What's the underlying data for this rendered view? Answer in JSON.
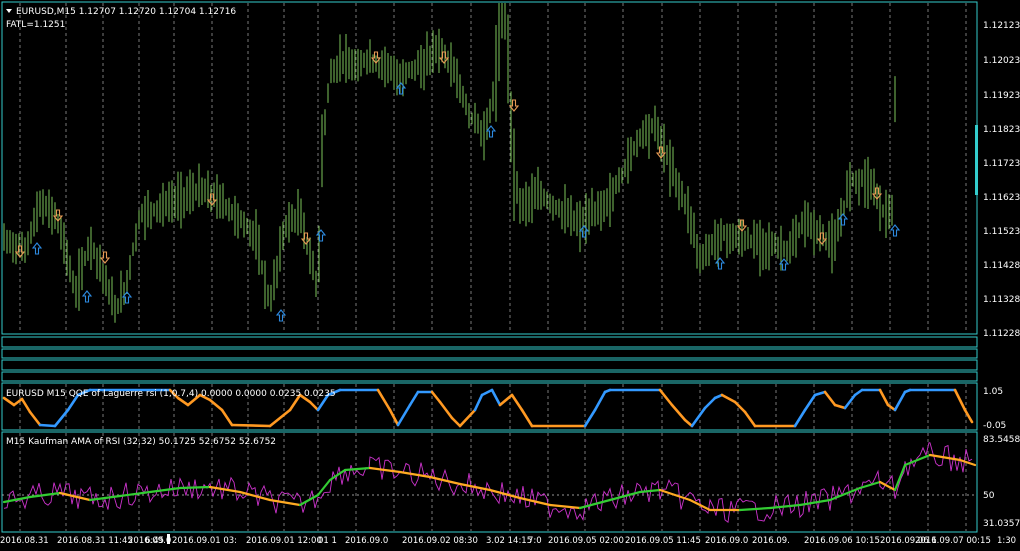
{
  "header": {
    "symbol_line": "EURUSD,M15  1.12707 1.12720 1.12704 1.12716",
    "indicator_line": "FATL=1.1251"
  },
  "main_price_axis": [
    "1.12123",
    "1.12023",
    "1.11923",
    "1.11823",
    "1.11723",
    "1.11623",
    "1.11523",
    "1.11428",
    "1.11328",
    "1.11228"
  ],
  "qqe_panel": {
    "title": "EURUSD M15 QQE of Laguerre rsi (1,0.7,4) 0.0000 0.0000 0.0235 0.0235",
    "axis": [
      "1.05",
      "-0.05"
    ]
  },
  "ama_panel": {
    "title": "M15 Kaufman AMA of RSI (32,32) 50.1725 52.6752 52.6752",
    "axis": [
      "83.5458",
      "50",
      "31.0357"
    ]
  },
  "time_axis": [
    "2016.08.31",
    "2016.08.31 11:45",
    "2016.09.0",
    "6:45",
    "2016.09.01 03:",
    "2016.09.01 12:00",
    "01 1",
    "2016.09.0",
    "2016.09.02 08:30",
    "3.02 14:15",
    "7:0",
    "2016.09.05 02:00",
    "2016.09.05 11:45",
    "2016.09.0",
    "2016.09.",
    "2016.09.06 10:15",
    "2016.09.06 1",
    "2016.09.07 00:15",
    "1:30"
  ],
  "colors": {
    "background": "#000000",
    "grid": "#c8c8c8",
    "candles": "#7bc35a",
    "down_arrow": "#e69a55",
    "up_arrow": "#2d8ae0",
    "qqe_orange": "#ff9922",
    "qqe_blue": "#3399ff",
    "ama_orange": "#ffaa22",
    "ama_green": "#33cc33",
    "rsi_magenta": "#cc33cc",
    "panel_border": "#33cccc"
  },
  "icons": [
    "arrow-up-icon",
    "arrow-down-icon",
    "triangle-down-icon"
  ]
}
